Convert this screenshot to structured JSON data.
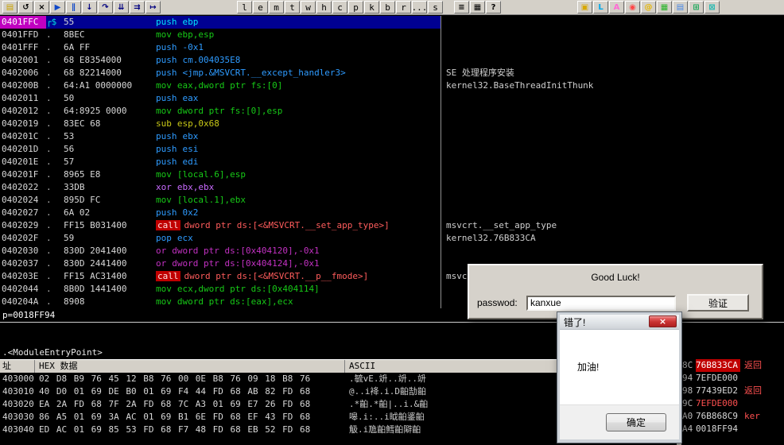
{
  "colors": {
    "selection_bg": "#000092",
    "eip_address_bg": "#c000c0",
    "call_highlight_bg": "#c00000",
    "stack_highlight_bg": "#c00000",
    "panel_gray": "#d4d0c8",
    "comment_text": "#cfcfcf",
    "red_text": "#ff5050"
  },
  "toolbar": {
    "icon_buttons": [
      {
        "name": "open-file-button",
        "glyph": "▤",
        "color": "#caa200"
      },
      {
        "name": "restart-button",
        "glyph": "↺",
        "color": "#000000"
      },
      {
        "name": "close-icon-button",
        "glyph": "×",
        "color": "#000000"
      },
      {
        "name": "run-button",
        "glyph": "▶",
        "color": "#1048c8"
      },
      {
        "name": "pause-button",
        "glyph": "∥",
        "color": "#1048c8"
      },
      {
        "name": "step-into-button",
        "glyph": "↓",
        "color": "#000080"
      },
      {
        "name": "step-over-button",
        "glyph": "↷",
        "color": "#000080"
      },
      {
        "name": "animate-into-button",
        "glyph": "⇊",
        "color": "#000080"
      },
      {
        "name": "animate-over-button",
        "glyph": "⇉",
        "color": "#000080"
      },
      {
        "name": "execute-till-return-button",
        "glyph": "↦",
        "color": "#000080"
      }
    ],
    "letter_buttons": [
      "l",
      "e",
      "m",
      "t",
      "w",
      "h",
      "c",
      "p",
      "k",
      "b",
      "r",
      "...",
      "s"
    ],
    "menu_buttons": [
      {
        "name": "options-button",
        "glyph": "≡",
        "color": "#000000"
      },
      {
        "name": "windows-button",
        "glyph": "▦",
        "color": "#000000"
      },
      {
        "name": "help-button",
        "glyph": "?",
        "color": "#000000"
      }
    ],
    "plugin_buttons": [
      {
        "name": "plugin-icon",
        "glyph": "▣",
        "color": "#d8a800"
      },
      {
        "name": "plugin-icon",
        "glyph": "L",
        "color": "#00a8e8"
      },
      {
        "name": "plugin-icon",
        "glyph": "A",
        "color": "#ff6ad5"
      },
      {
        "name": "plugin-icon",
        "glyph": "◉",
        "color": "#ff4545"
      },
      {
        "name": "plugin-icon",
        "glyph": "@",
        "color": "#e8b800"
      },
      {
        "name": "plugin-icon",
        "glyph": "▦",
        "color": "#28b428"
      },
      {
        "name": "plugin-icon",
        "glyph": "▤",
        "color": "#4888e8"
      },
      {
        "name": "plugin-icon",
        "glyph": "⊞",
        "color": "#18a858"
      },
      {
        "name": "plugin-icon",
        "glyph": "⊠",
        "color": "#18b8b0"
      }
    ]
  },
  "cpu": {
    "info_line": "p=0018FF94",
    "module_line": ".<ModuleEntryPoint>",
    "rows": [
      {
        "address": "0401FFC",
        "mark": "┌$",
        "bytes": "55",
        "kind": "push",
        "mnemonic": "push",
        "operands": "ebp",
        "comment": "",
        "selected": true
      },
      {
        "address": "0401FFD",
        "mark": ".",
        "bytes": "8BEC",
        "kind": "mov",
        "mnemonic": "mov",
        "operands": "ebp,esp",
        "comment": ""
      },
      {
        "address": "0401FFF",
        "mark": ".",
        "bytes": "6A FF",
        "kind": "push",
        "mnemonic": "push",
        "operands": "-0x1",
        "comment": ""
      },
      {
        "address": "0402001",
        "mark": ".",
        "bytes": "68 E8354000",
        "kind": "push",
        "mnemonic": "push",
        "operands": "cm.004035E8",
        "comment": ""
      },
      {
        "address": "0402006",
        "mark": ".",
        "bytes": "68 82214000",
        "kind": "push",
        "mnemonic": "push",
        "operands": "<jmp.&MSVCRT.__except_handler3>",
        "comment": "SE 处理程序安装"
      },
      {
        "address": "040200B",
        "mark": ".",
        "bytes": "64:A1 0000000",
        "kind": "mov",
        "mnemonic": "mov",
        "operands": "eax,dword ptr fs:[0]",
        "comment": "kernel32.BaseThreadInitThunk"
      },
      {
        "address": "0402011",
        "mark": ".",
        "bytes": "50",
        "kind": "push",
        "mnemonic": "push",
        "operands": "eax",
        "comment": ""
      },
      {
        "address": "0402012",
        "mark": ".",
        "bytes": "64:8925 0000",
        "kind": "mov",
        "mnemonic": "mov",
        "operands": "dword ptr fs:[0],esp",
        "comment": ""
      },
      {
        "address": "0402019",
        "mark": ".",
        "bytes": "83EC 68",
        "kind": "sub",
        "mnemonic": "sub",
        "operands": "esp,0x68",
        "comment": ""
      },
      {
        "address": "040201C",
        "mark": ".",
        "bytes": "53",
        "kind": "push",
        "mnemonic": "push",
        "operands": "ebx",
        "comment": ""
      },
      {
        "address": "040201D",
        "mark": ".",
        "bytes": "56",
        "kind": "push",
        "mnemonic": "push",
        "operands": "esi",
        "comment": ""
      },
      {
        "address": "040201E",
        "mark": ".",
        "bytes": "57",
        "kind": "push",
        "mnemonic": "push",
        "operands": "edi",
        "comment": ""
      },
      {
        "address": "040201F",
        "mark": ".",
        "bytes": "8965 E8",
        "kind": "mov",
        "mnemonic": "mov",
        "operands": "[local.6],esp",
        "comment": ""
      },
      {
        "address": "0402022",
        "mark": ".",
        "bytes": "33DB",
        "kind": "xor",
        "mnemonic": "xor",
        "operands": "ebx,ebx",
        "comment": ""
      },
      {
        "address": "0402024",
        "mark": ".",
        "bytes": "895D FC",
        "kind": "mov",
        "mnemonic": "mov",
        "operands": "[local.1],ebx",
        "comment": ""
      },
      {
        "address": "0402027",
        "mark": ".",
        "bytes": "6A 02",
        "kind": "push",
        "mnemonic": "push",
        "operands": "0x2",
        "comment": ""
      },
      {
        "address": "0402029",
        "mark": ".",
        "bytes": "FF15 B031400",
        "kind": "call",
        "mnemonic": "call",
        "operands": "dword ptr ds:[<&MSVCRT.__set_app_type>]",
        "comment": "msvcrt.__set_app_type"
      },
      {
        "address": "040202F",
        "mark": ".",
        "bytes": "59",
        "kind": "pop",
        "mnemonic": "pop",
        "operands": "ecx",
        "comment": "kernel32.76B833CA"
      },
      {
        "address": "0402030",
        "mark": ".",
        "bytes": "830D 2041400",
        "kind": "or",
        "mnemonic": "or",
        "operands": "dword ptr ds:[0x404120],-0x1",
        "comment": ""
      },
      {
        "address": "0402037",
        "mark": ".",
        "bytes": "830D 2441400",
        "kind": "or",
        "mnemonic": "or",
        "operands": "dword ptr ds:[0x404124],-0x1",
        "comment": ""
      },
      {
        "address": "040203E",
        "mark": ".",
        "bytes": "FF15 AC31400",
        "kind": "call",
        "mnemonic": "call",
        "operands": "dword ptr ds:[<&MSVCRT.__p__fmode>]",
        "comment": "msvc"
      },
      {
        "address": "0402044",
        "mark": ".",
        "bytes": "8B0D 1441400",
        "kind": "mov",
        "mnemonic": "mov",
        "operands": "ecx,dword ptr ds:[0x404114]",
        "comment": ""
      },
      {
        "address": "040204A",
        "mark": ".",
        "bytes": "8908",
        "kind": "mov",
        "mnemonic": "mov",
        "operands": "dword ptr ds:[eax],ecx",
        "comment": ""
      }
    ]
  },
  "dump": {
    "headers": {
      "address": "址",
      "hex": "HEX 数据",
      "ascii": "ASCII"
    },
    "rows": [
      {
        "address": "403000",
        "hex": "02 D8 B9 76 45 12 B8 76 00 0E B8 76 09 18 B8 76",
        "ascii": ".毓vE.竔..竔..竔"
      },
      {
        "address": "403010",
        "hex": "40 D0 01 69 DE B0 01 69 F4 44 FD 68 AB 82 FD 68",
        "ascii": "@..i袶.i.D齨勂齨"
      },
      {
        "address": "403020",
        "hex": "EA 2A FD 68 7F 2A FD 68 7C A3 01 69 E7 26 FD 68",
        "ascii": ".*齨.*齨|..i.&齨"
      },
      {
        "address": "403030",
        "hex": "86 A5 01 69 3A AC 01 69 B1 6E FD 68 EF 43 FD 68",
        "ascii": "嗥.i:..i眓齨錃齨"
      },
      {
        "address": "403040",
        "hex": "ED AC 01 69 85 53 FD 68 F7 48 FD 68 EB 52 FD 68",
        "ascii": "觙.i卼齨鱈齨隦齨"
      }
    ]
  },
  "stack": {
    "rows": [
      {
        "addr": "8C",
        "value": "76B833CA",
        "style": "hl",
        "comment": "返回"
      },
      {
        "addr": "94",
        "value": "7EFDE000",
        "style": "normal",
        "comment": ""
      },
      {
        "addr": "98",
        "value": "77439ED2",
        "style": "normal",
        "comment": "返回"
      },
      {
        "addr": "9C",
        "value": "7EFDE000",
        "style": "red",
        "comment": ""
      },
      {
        "addr": "A0",
        "value": "76B868C9",
        "style": "normal",
        "comment": "ker"
      },
      {
        "addr": "A4",
        "value": "0018FF94",
        "style": "normal",
        "comment": ""
      }
    ]
  },
  "dialogs": {
    "good_luck": {
      "title": "Good Luck!",
      "password_label": "passwod:",
      "password_value": "kanxue",
      "verify_button": "验证"
    },
    "error": {
      "title": "错了!",
      "message": "加油!",
      "ok_button": "确定",
      "close_glyph": "×"
    }
  }
}
